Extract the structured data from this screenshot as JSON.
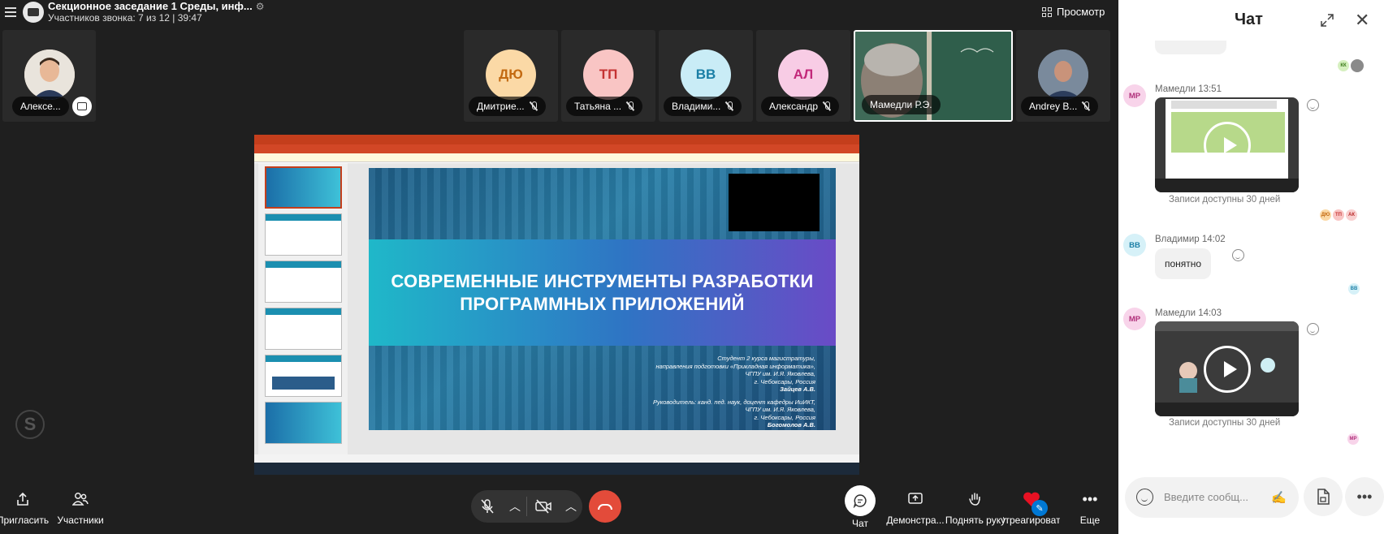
{
  "call": {
    "title": "Секционное заседание 1  Среды, инф...",
    "subtitle": "Участников звонка: 7 из 12 | 39:47",
    "view_label": "Просмотр"
  },
  "participants": [
    {
      "initials": "",
      "name": "Алексе...",
      "color": "#f6c9a8"
    },
    {
      "initials": "ДЮ",
      "name": "Дмитрие...",
      "color": "#fbd9a6",
      "text_color": "#c36a12"
    },
    {
      "initials": "ТП",
      "name": "Татьяна ...",
      "color": "#f9c5c4",
      "text_color": "#c43232"
    },
    {
      "initials": "ВВ",
      "name": "Владими...",
      "color": "#c9ecf6",
      "text_color": "#1b7fa6"
    },
    {
      "initials": "АЛ",
      "name": "Александр",
      "color": "#f8cce5",
      "text_color": "#c2287a"
    },
    {
      "initials": "",
      "name": "Мамедли Р.Э.",
      "color": "#3a5a4c"
    },
    {
      "initials": "",
      "name": "Andrey B...",
      "color": "#5b6b7e"
    }
  ],
  "slide": {
    "heading_line1": "СОВРЕМЕННЫЕ ИНСТРУМЕНТЫ РАЗРАБОТКИ",
    "heading_line2": "ПРОГРАММНЫХ ПРИЛОЖЕНИЙ",
    "credit_lines": [
      "Студент 2 курса магистратуры,",
      "направления подготовки «Прикладная информатика»,",
      "ЧГПУ им. И.Я. Яковлева,",
      "г. Чебоксары, Россия",
      "Зайцев А.В.",
      "",
      "Руководитель: канд. пед. наук, доцент кафедры ИиИКТ,",
      "ЧГПУ им. И.Я. Яковлева,",
      "г. Чебоксары, Россия",
      "Богомолов А.В."
    ]
  },
  "controls": {
    "invite": "Пригласить",
    "people": "Участники",
    "chat": "Чат",
    "share": "Демонстра...",
    "raise_hand": "Поднять руку",
    "react": "Отреагировать",
    "more": "Еще"
  },
  "chat": {
    "title": "Чат",
    "messages": [
      {
        "initials": "MP",
        "meta": "Мамедли 13:51",
        "type": "video",
        "note": "Записи доступны 30 дней"
      },
      {
        "initials": "BB",
        "meta": "Владимир 14:02",
        "type": "text",
        "text": "понятно"
      },
      {
        "initials": "MP",
        "meta": "Мамедли 14:03",
        "type": "video",
        "note": "Записи доступны 30 дней"
      }
    ],
    "read_receipts_1": [
      "ДЮ",
      "ТП",
      "АК"
    ],
    "read_receipts_top": [
      "КК"
    ],
    "read_receipt_2": "BB",
    "read_receipt_3": "MP",
    "input_placeholder": "Введите сообщ..."
  },
  "colors": {
    "background": "#1f1f1f",
    "hangup": "#e34b3a",
    "react_heart": "#e81123",
    "accent": "#0078d4"
  }
}
